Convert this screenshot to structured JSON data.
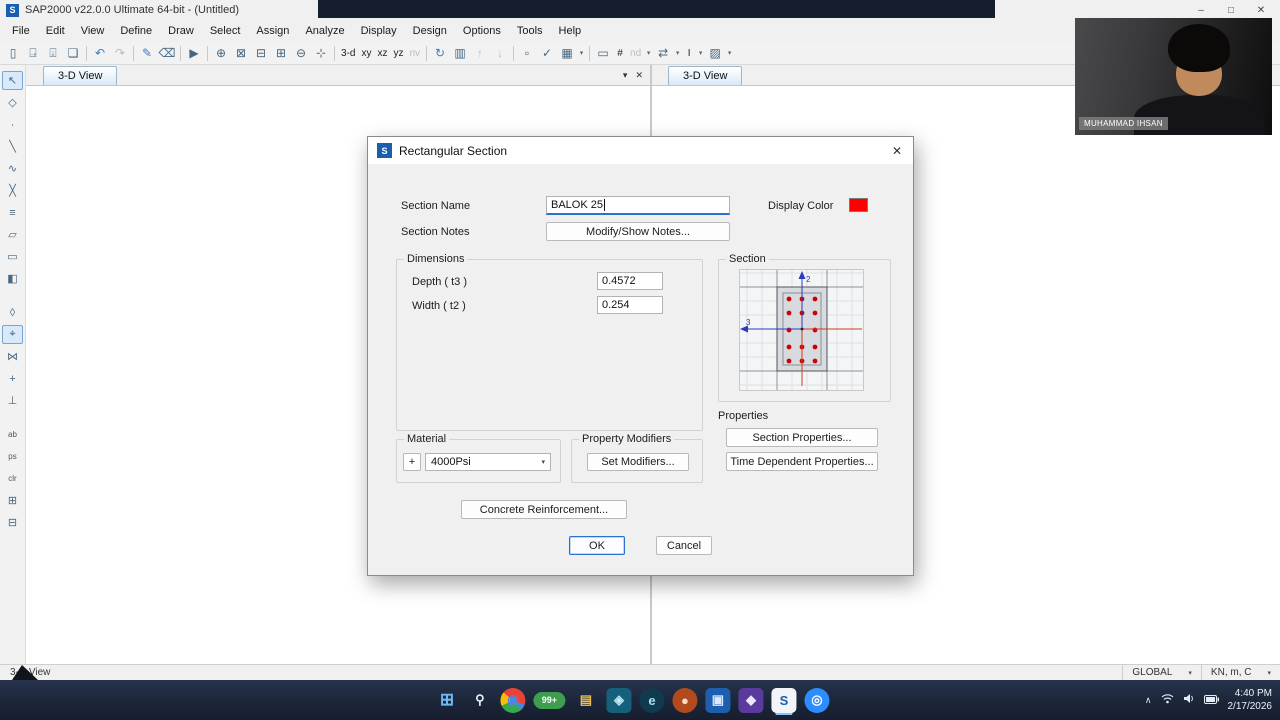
{
  "glyphs": {
    "dropdown": "▾",
    "close": "✕"
  },
  "titlebar": {
    "app_icon_letter": "S",
    "title": "SAP2000 v22.0.0 Ultimate 64-bit - (Untitled)",
    "minimize": "–",
    "maximize": "□",
    "close": "✕"
  },
  "menubar": {
    "items": [
      "File",
      "Edit",
      "View",
      "Define",
      "Draw",
      "Select",
      "Assign",
      "Analyze",
      "Display",
      "Design",
      "Options",
      "Tools",
      "Help"
    ]
  },
  "toolbar": {
    "icons": [
      {
        "name": "new-model-icon",
        "glyph": "▯"
      },
      {
        "name": "open-file-icon",
        "glyph": "⍈"
      },
      {
        "name": "save-model-icon",
        "glyph": "⍗"
      },
      {
        "name": "print-icon",
        "glyph": "❏"
      },
      {
        "sep": true
      },
      {
        "name": "undo-icon",
        "glyph": "↶",
        "cls": "blue"
      },
      {
        "name": "redo-icon",
        "glyph": "↷",
        "disabled": true
      },
      {
        "sep": true
      },
      {
        "name": "edit-icon",
        "glyph": "✎",
        "cls": "blue"
      },
      {
        "name": "delete-icon",
        "glyph": "⌫"
      },
      {
        "sep": true
      },
      {
        "name": "run-analysis-icon",
        "glyph": "▶"
      },
      {
        "sep": true
      },
      {
        "name": "rubber-band-zoom-icon",
        "glyph": "⊕"
      },
      {
        "name": "restore-full-view-icon",
        "glyph": "⊠"
      },
      {
        "name": "previous-zoom-icon",
        "glyph": "⊟"
      },
      {
        "name": "zoom-in-icon",
        "glyph": "⊞"
      },
      {
        "name": "zoom-out-icon",
        "glyph": "⊖"
      },
      {
        "name": "pan-icon",
        "glyph": "⊹"
      },
      {
        "sep": true
      },
      {
        "name": "view-3d-button",
        "glyph": "3-d",
        "cls": "txt"
      },
      {
        "name": "view-xy-button",
        "glyph": "xy",
        "cls": "txt"
      },
      {
        "name": "view-xz-button",
        "glyph": "xz",
        "cls": "txt"
      },
      {
        "name": "view-yz-button",
        "glyph": "yz",
        "cls": "txt"
      },
      {
        "name": "view-nv-button",
        "glyph": "nv",
        "cls": "txt",
        "disabled": true
      },
      {
        "sep": true
      },
      {
        "name": "rotate-view-icon",
        "glyph": "↻",
        "cls": "blue"
      },
      {
        "name": "perspective-toggle-icon",
        "glyph": "▥"
      },
      {
        "name": "move-up-in-list-icon",
        "glyph": "↑",
        "disabled": true
      },
      {
        "name": "move-down-in-list-icon",
        "glyph": "↓",
        "disabled": true
      },
      {
        "sep": true
      },
      {
        "name": "shrink-objects-icon",
        "glyph": "▫"
      },
      {
        "name": "set-display-options-icon",
        "glyph": "✓"
      },
      {
        "name": "object-display-icon",
        "glyph": "▦"
      },
      {
        "name": "dropdown-arrow-icon",
        "glyph": "▾",
        "cls": "dd"
      },
      {
        "sep": true
      },
      {
        "name": "draw-window-icon",
        "glyph": "▭"
      },
      {
        "name": "section-cut-icon",
        "glyph": "#",
        "cls": "txt"
      },
      {
        "name": "nd-spectra-button",
        "glyph": "nd",
        "cls": "txt",
        "disabled": true
      },
      {
        "name": "dropdown-arrow-icon",
        "glyph": "▾",
        "cls": "dd"
      },
      {
        "name": "model-alive-icon",
        "glyph": "⇄"
      },
      {
        "name": "dropdown-arrow-icon",
        "glyph": "▾",
        "cls": "dd"
      },
      {
        "name": "text-annotate-button",
        "glyph": "I",
        "cls": "txt"
      },
      {
        "name": "dropdown-arrow-icon",
        "glyph": "▾",
        "cls": "dd"
      },
      {
        "name": "display-pattern-icon",
        "glyph": "▨"
      },
      {
        "name": "dropdown-arrow-icon",
        "glyph": "▾",
        "cls": "dd"
      }
    ]
  },
  "left_toolbar": {
    "icons": [
      {
        "name": "select-pointer-icon",
        "glyph": "↖",
        "active": true
      },
      {
        "name": "reshape-icon",
        "glyph": "◇"
      },
      {
        "name": "draw-joint-icon",
        "glyph": "∙"
      },
      {
        "name": "draw-frame-icon",
        "glyph": "╲"
      },
      {
        "name": "quick-draw-frame-icon",
        "glyph": "∿"
      },
      {
        "name": "quick-draw-brace-icon",
        "glyph": "╳"
      },
      {
        "name": "quick-draw-secondary-beams-icon",
        "glyph": "≡"
      },
      {
        "name": "draw-quad-area-icon",
        "glyph": "▱"
      },
      {
        "name": "draw-rect-area-icon",
        "glyph": "▭"
      },
      {
        "name": "quick-draw-area-icon",
        "glyph": "◧"
      },
      {
        "gap": true
      },
      {
        "name": "draw-poly-area-icon",
        "glyph": "◊"
      },
      {
        "name": "snap-joints-icon",
        "glyph": "⌖",
        "active": true
      },
      {
        "name": "snap-midpoints-icon",
        "glyph": "⋈"
      },
      {
        "name": "snap-intersections-icon",
        "glyph": "+"
      },
      {
        "name": "snap-perpendicular-icon",
        "glyph": "⊥"
      },
      {
        "gap": true
      },
      {
        "name": "show-undeformed-icon",
        "glyph": "ab",
        "cls": "txt"
      },
      {
        "name": "named-display-icon",
        "glyph": "ps",
        "cls": "txt"
      },
      {
        "name": "clear-display-icon",
        "glyph": "clr",
        "cls": "txt"
      },
      {
        "name": "select-all-icon",
        "glyph": "⊞"
      },
      {
        "name": "get-previous-selection-icon",
        "glyph": "⊟"
      }
    ]
  },
  "panels": {
    "left_tab": "3-D View",
    "right_tab": "3-D View"
  },
  "dialog": {
    "icon_letter": "S",
    "title": "Rectangular Section",
    "section_name_label": "Section Name",
    "section_name_value": "BALOK 25",
    "display_color_label": "Display Color",
    "display_color": "#fe0000",
    "section_notes_label": "Section Notes",
    "modify_show_notes_button": "Modify/Show Notes...",
    "dimensions_label": "Dimensions",
    "depth_label": "Depth ( t3 )",
    "depth_value": "0.4572",
    "width_label": "Width ( t2 )",
    "width_value": "0.254",
    "section_label": "Section",
    "axis_2": "2",
    "axis_3": "3",
    "properties_label": "Properties",
    "section_properties_button": "Section Properties...",
    "time_dependent_button": "Time Dependent Properties...",
    "material_label": "Material",
    "material_add_button": "+",
    "material_value": "4000Psi",
    "property_modifiers_label": "Property Modifiers",
    "set_modifiers_button": "Set Modifiers...",
    "concrete_reinforcement_button": "Concrete Reinforcement...",
    "ok_button": "OK",
    "cancel_button": "Cancel"
  },
  "statusbar": {
    "view_label": "3-D View",
    "coord_system": "GLOBAL",
    "units": "KN, m, C"
  },
  "taskbar": {
    "icons": [
      {
        "name": "start-button",
        "glyph": "⊞",
        "color": "#6db8f5",
        "cls": "start"
      },
      {
        "name": "search-icon",
        "glyph": "⚲",
        "color": "#e8edf3"
      },
      {
        "name": "chrome-icon",
        "glyph": "◉",
        "color": "#4d86e8",
        "round": true,
        "bg": "conic-gradient(from 0deg, #ea4335 0deg 110deg, #4285f4 110deg 135deg, #34a853 135deg 245deg, #fbbc05 245deg 310deg, #ea4335 310deg 360deg)"
      },
      {
        "name": "battery-widget",
        "glyph": "99+",
        "bg": "#3e9e4f",
        "color": "#ffffff",
        "cls": "badge"
      },
      {
        "name": "file-explorer-icon",
        "glyph": "▤",
        "color": "#f3c14b"
      },
      {
        "name": "app-icon-media",
        "glyph": "◈",
        "color": "#bfe9f5",
        "bg": "#15607a"
      },
      {
        "name": "app-icon-edge",
        "glyph": "e",
        "color": "#9fe0ef",
        "bg": "#123a4f",
        "round": true
      },
      {
        "name": "app-icon-football",
        "glyph": "●",
        "color": "#ffd9c2",
        "bg": "#b34a1e",
        "round": true
      },
      {
        "name": "app-icon-blue",
        "glyph": "▣",
        "color": "#d6e9ff",
        "bg": "#1d5fae"
      },
      {
        "name": "app-icon-purple",
        "glyph": "◆",
        "color": "#efe5ff",
        "bg": "#5b3a9e"
      },
      {
        "name": "sap2000-taskbar-icon",
        "glyph": "S",
        "color": "#1a5fae",
        "bg": "#f2f4f7",
        "active": true
      },
      {
        "name": "zoom-app-icon",
        "glyph": "◎",
        "color": "#ffffff",
        "bg": "#2d8cff",
        "round": true
      }
    ],
    "tray_chevron": "∧",
    "time": "4:40 PM",
    "date": "2/17/2026"
  },
  "webcam": {
    "name_tag": "MUHAMMAD IHSAN"
  }
}
